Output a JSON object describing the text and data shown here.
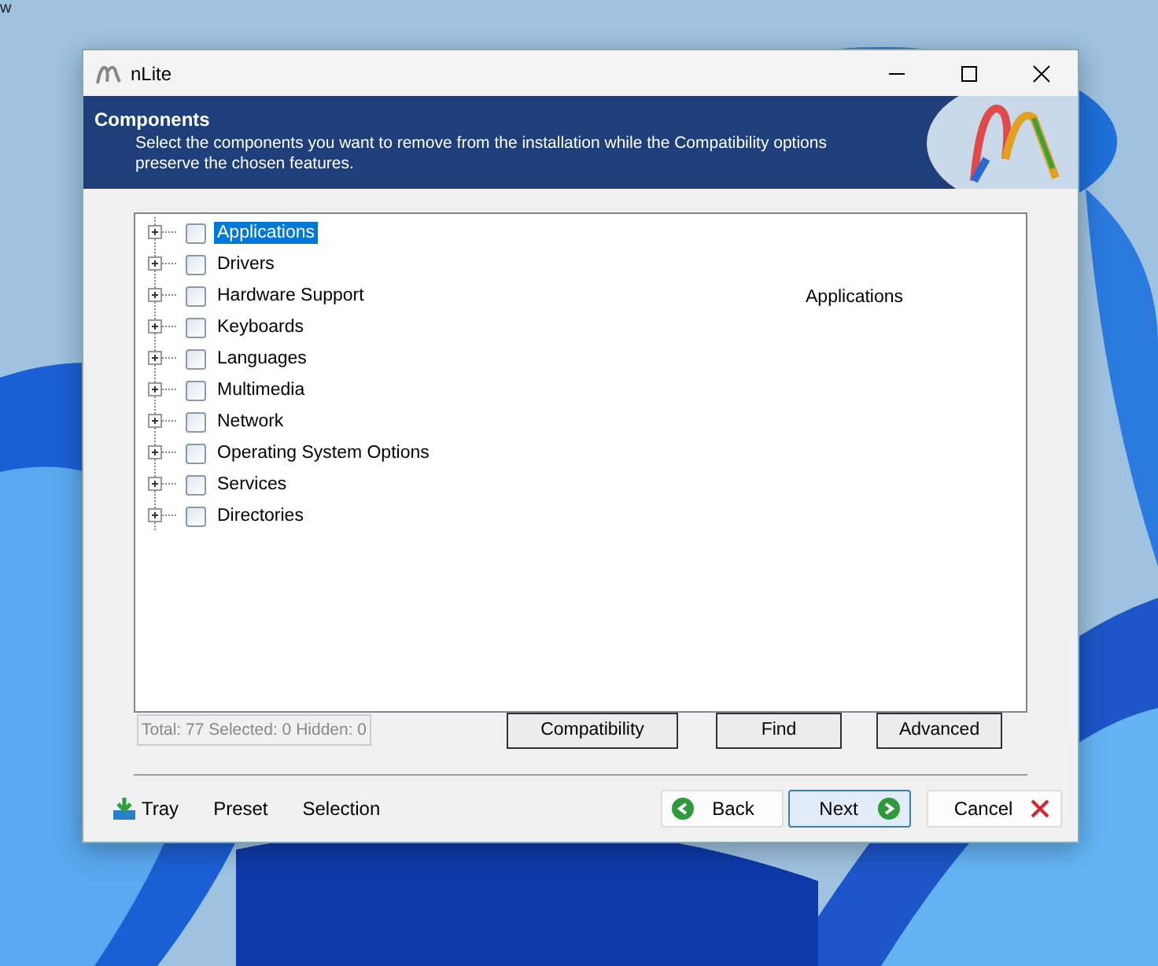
{
  "desktop_label": "w",
  "window": {
    "title": "nLite"
  },
  "header": {
    "title": "Components",
    "description": "Select the components you want to remove from the installation while the Compatibility options preserve the chosen features."
  },
  "tree": [
    {
      "label": "Applications",
      "selected": true,
      "checked": false
    },
    {
      "label": "Drivers",
      "selected": false,
      "checked": false
    },
    {
      "label": "Hardware Support",
      "selected": false,
      "checked": false
    },
    {
      "label": "Keyboards",
      "selected": false,
      "checked": false
    },
    {
      "label": "Languages",
      "selected": false,
      "checked": false
    },
    {
      "label": "Multimedia",
      "selected": false,
      "checked": false
    },
    {
      "label": "Network",
      "selected": false,
      "checked": false
    },
    {
      "label": "Operating System Options",
      "selected": false,
      "checked": false
    },
    {
      "label": "Services",
      "selected": false,
      "checked": false
    },
    {
      "label": "Directories",
      "selected": false,
      "checked": false
    }
  ],
  "detail_label": "Applications",
  "status": "Total: 77 Selected: 0 Hidden: 0",
  "panel_buttons": [
    "Compatibility",
    "Find",
    "Advanced"
  ],
  "footer_links": [
    {
      "label": "Tray",
      "kind": "icon"
    },
    {
      "label": "Preset",
      "kind": "text"
    },
    {
      "label": "Selection",
      "kind": "text"
    }
  ],
  "nav_buttons": [
    {
      "label": "Back",
      "kind": "back",
      "focused": false
    },
    {
      "label": "Next",
      "kind": "next",
      "focused": true
    },
    {
      "label": "Cancel",
      "kind": "cancel",
      "focused": false
    }
  ]
}
